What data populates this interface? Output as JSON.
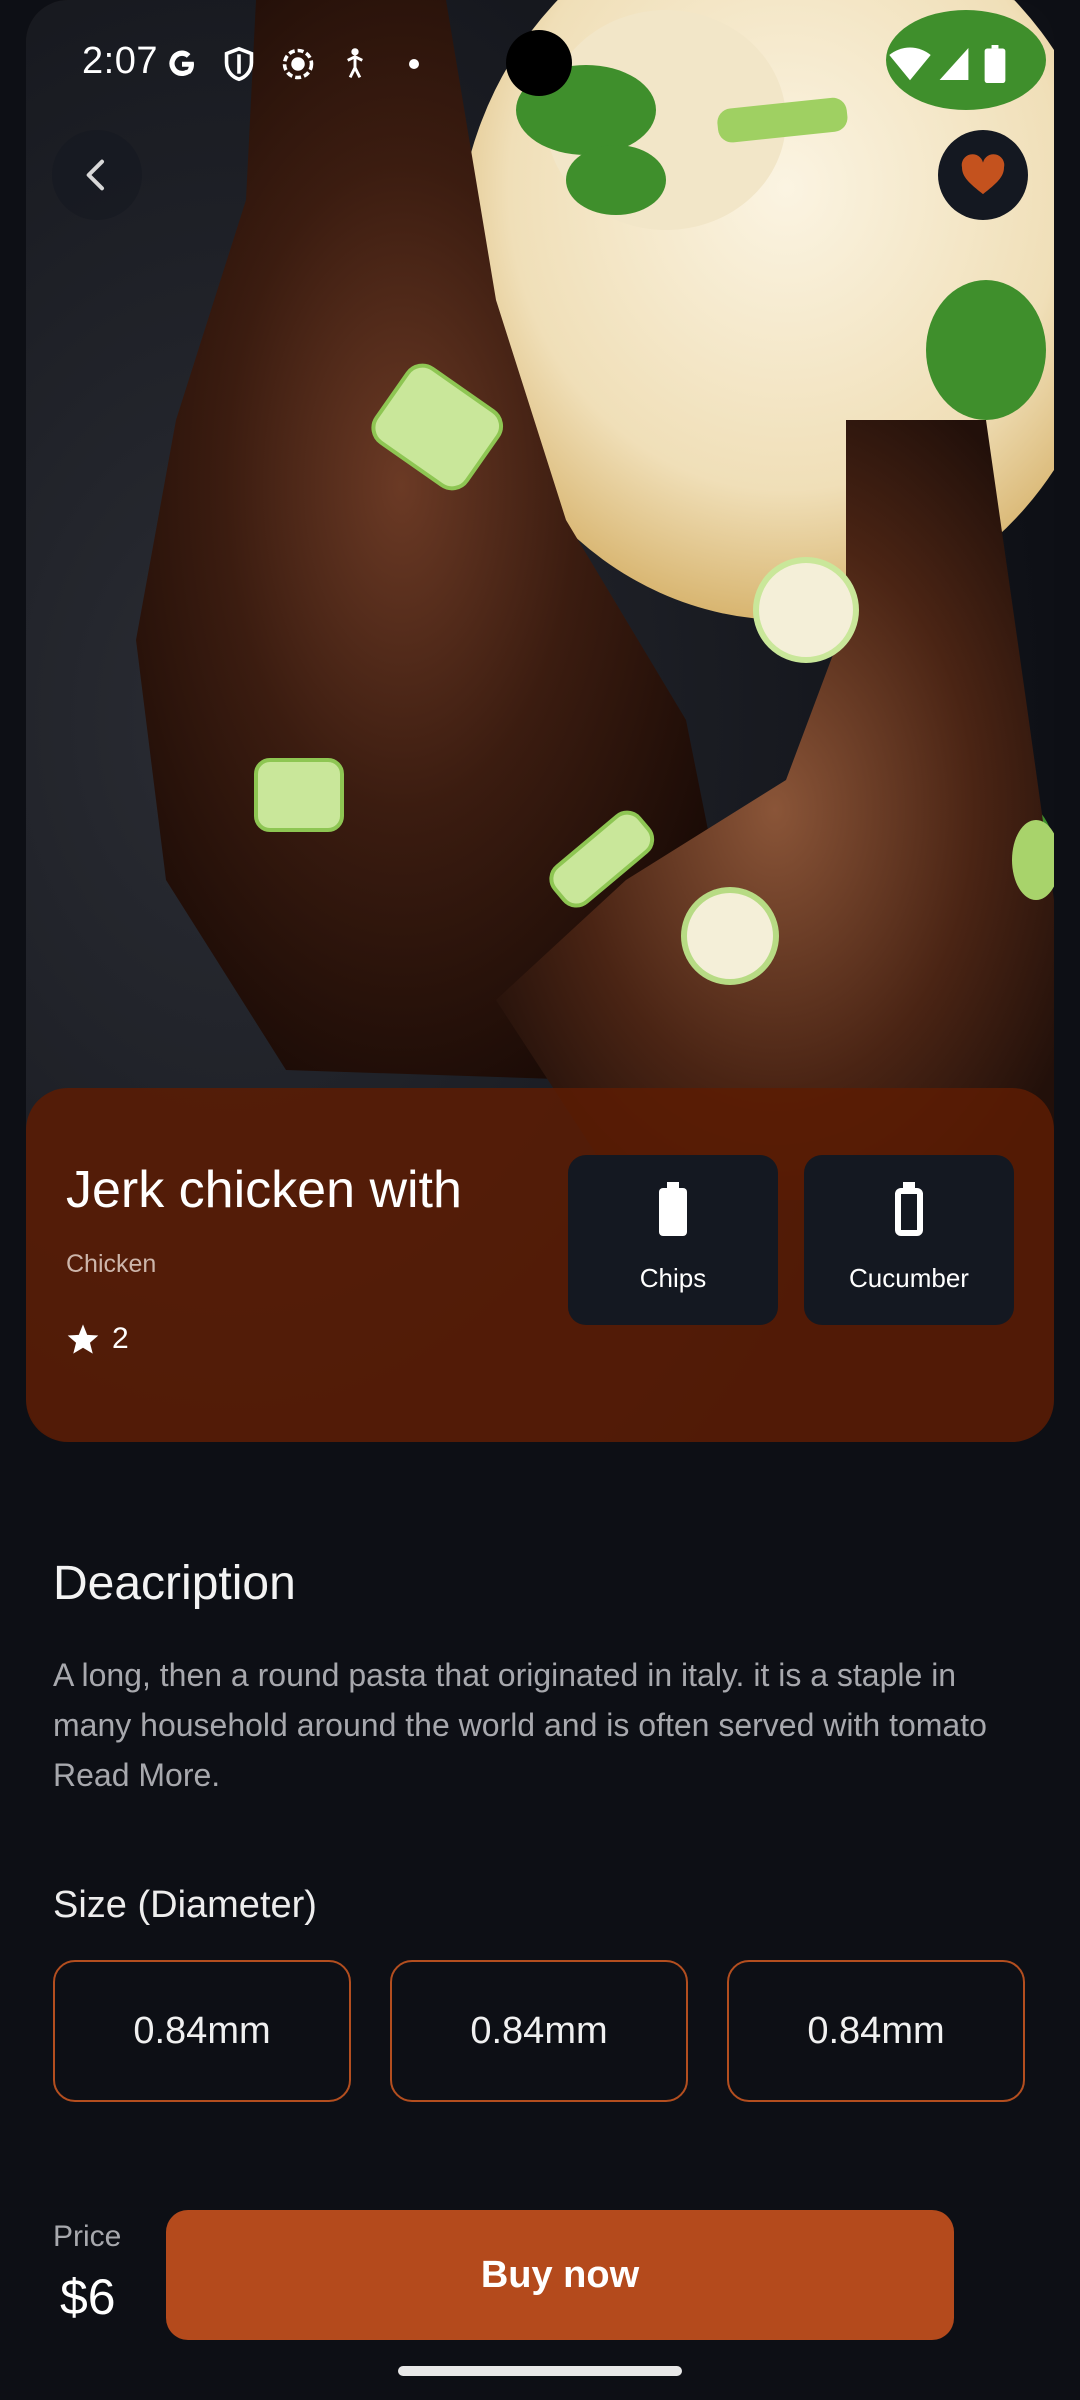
{
  "status_bar": {
    "time": "2:07",
    "icons": [
      "google-g-icon",
      "shield-icon",
      "screen-record-icon",
      "accessibility-icon",
      "dot-icon",
      "wifi-icon",
      "signal-icon",
      "battery-icon"
    ]
  },
  "top_actions": {
    "back_icon": "chevron-left-icon",
    "favorite_icon": "heart-icon",
    "favorite_color": "#c4521e"
  },
  "dish": {
    "title": "Jerk chicken with",
    "category": "Chicken",
    "rating": "2"
  },
  "ingredients": [
    {
      "label": "Chips",
      "icon": "battery-full-icon"
    },
    {
      "label": "Cucumber",
      "icon": "battery-empty-icon"
    }
  ],
  "description": {
    "heading": "Deacription",
    "text": "A long, then a round pasta that originated in italy. it is a staple in many household around the world and is often served with tomato Read More."
  },
  "size": {
    "heading": "Size (Diameter)",
    "options": [
      "0.84mm",
      "0.84mm",
      "0.84mm"
    ]
  },
  "purchase": {
    "price_label": "Price",
    "price": "$6",
    "buy_label": "Buy now",
    "accent": "#b44a1c"
  }
}
